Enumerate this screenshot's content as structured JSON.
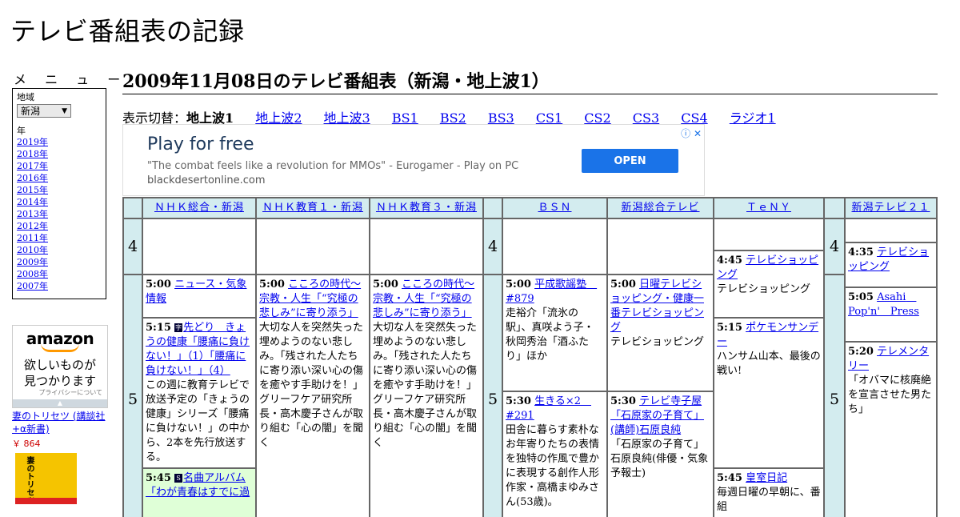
{
  "site": {
    "title": "テレビ番組表の記録"
  },
  "menu": {
    "heading": "メ ニ ュ ー",
    "region_label": "地域",
    "region_value": "新潟",
    "year_label": "年",
    "years": [
      "2019年",
      "2018年",
      "2017年",
      "2016年",
      "2015年",
      "2014年",
      "2013年",
      "2012年",
      "2011年",
      "2010年",
      "2009年",
      "2008年",
      "2007年"
    ]
  },
  "amazon_ad": {
    "logo": "amazon",
    "tagline_1": "欲しいものが",
    "tagline_2": "見つかります",
    "privacy": "プライバシーについて",
    "book_title": "妻のトリセツ (講談社+α新書)",
    "book_price": "￥ 864",
    "cover_text": "妻のトリセツ"
  },
  "page": {
    "heading": "2009年11月08日のテレビ番組表（新潟・地上波1）",
    "switch_prefix": "表示切替：",
    "current": "地上波1",
    "switch_links": [
      "地上波2",
      "地上波3",
      "BS1",
      "BS2",
      "BS3",
      "CS1",
      "CS2",
      "CS3",
      "CS4",
      "ラジオ1"
    ]
  },
  "ad_banner": {
    "headline": "Play for free",
    "quote": "\"The combat feels like a revolution for MMOs\" - Eurogamer - Play on PC",
    "domain": "blackdesertonline.com",
    "cta": "OPEN",
    "choices_icon": "ⓘ ✕"
  },
  "schedule": {
    "channels": [
      "ＮＨＫ総合・新潟",
      "ＮＨＫ教育１・新潟",
      "ＮＨＫ教育３・新潟",
      "ＢＳＮ",
      "新潟総合テレビ",
      "ＴｅＮＹ",
      "新潟テレビ２１"
    ],
    "hours": [
      "4",
      "5"
    ],
    "programs": [
      {
        "time": "5:00",
        "title": "ニュース・気象情報",
        "desc": ""
      },
      {
        "time": "5:15",
        "badge": "字",
        "title": "先どり　きょうの健康「腰痛に負けない！」（1）「腰痛に負けない！」（4）",
        "desc": "この週に教育テレビで放送予定の「きょうの健康」シリーズ「腰痛に負けない！」の中から、2本を先行放送する。"
      },
      {
        "time": "5:45",
        "badge": "S",
        "title": "名曲アルバム「わが青春はすでに過",
        "desc": ""
      },
      {
        "time": "5:00",
        "title": "こころの時代～宗教・人生「“究極の悲しみ”に寄り添う」",
        "desc": "大切な人を突然失った埋めようのない悲しみ。「残された人たちに寄り添い深い心の傷を癒やす手助けを！」グリーフケア研究所長・高木慶子さんが取り組む「心の闇」を聞く"
      },
      {
        "time": "5:00",
        "title": "こころの時代～宗教・人生「“究極の悲しみ”に寄り添う」",
        "desc": "大切な人を突然失った埋めようのない悲しみ。「残された人たちに寄り添い深い心の傷を癒やす手助けを！」グリーフケア研究所長・高木慶子さんが取り組む「心の闇」を聞く"
      },
      {
        "time": "5:00",
        "title": "平成歌謡塾　#879",
        "desc": "走裕介「流氷の駅」、真咲よう子・秋岡秀治「酒ふたり」ほか"
      },
      {
        "time": "5:30",
        "title": "生きる×2　#291",
        "desc": "田舎に暮らす素朴なお年寄りたちの表情を独特の作風で豊かに表現する創作人形作家・高橋まゆみさん(53歳)。"
      },
      {
        "time": "5:00",
        "title": "日曜テレビショッピング・健康一番テレビショッピング",
        "desc": "テレビショッピング"
      },
      {
        "time": "5:30",
        "title": "テレビ寺子屋「石原家の子育て」(講師)石原良純",
        "desc": "「石原家の子育て」石原良純(俳優・気象予報士)"
      },
      {
        "time": "4:45",
        "title": "テレビショッピング",
        "desc": "テレビショッピング"
      },
      {
        "time": "5:15",
        "title": "ポケモンサンデー",
        "desc": "ハンサム山本、最後の戦い!"
      },
      {
        "time": "5:45",
        "title": "皇室日記",
        "desc": "毎週日曜の早朝に、番組"
      },
      {
        "time": "4:35",
        "title": "テレビショッピング",
        "desc": ""
      },
      {
        "time": "5:05",
        "title": "Asahi　Pop'n'　Press",
        "desc": ""
      },
      {
        "time": "5:20",
        "title": "テレメンタリー",
        "desc": "「オバマに核廃絶を宣言させた男たち」"
      }
    ]
  }
}
